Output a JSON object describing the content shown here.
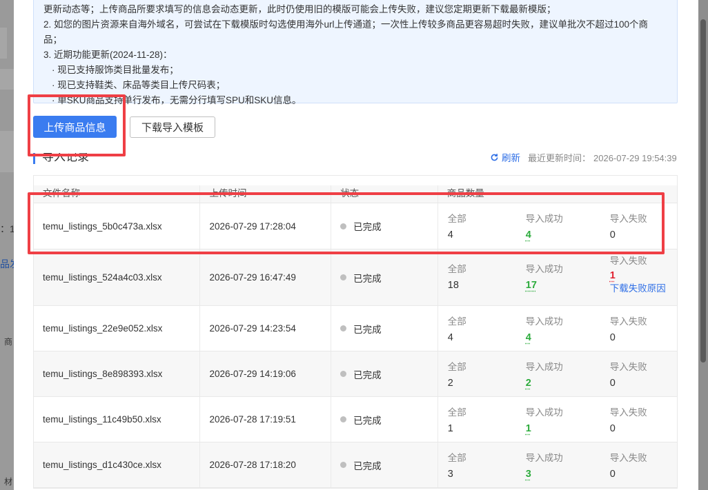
{
  "backdrop": {
    "fragment_a": "：1",
    "fragment_b": "品发",
    "fragment_c": "商",
    "fragment_d": "材"
  },
  "notice": {
    "lines": [
      "更新动态等；上传商品所要求填写的信息会动态更新，此时仍使用旧的模版可能会上传失败，建议您定期更新下载最新模版；",
      "2. 如您的图片资源来自海外域名，可尝试在下载模版时勾选使用海外url上传通道；一次性上传较多商品更容易超时失败，建议单批次不超过100个商",
      "品；",
      "3. 近期功能更新(2024-11-28)：",
      "· 现已支持服饰类目批量发布；",
      "· 现已支持鞋类、床品等类目上传尺码表；",
      "· 单SKU商品支持单行发布，无需分行填写SPU和SKU信息。"
    ]
  },
  "buttons": {
    "upload": "上传商品信息",
    "download_template": "下载导入模板"
  },
  "section": {
    "title": "导入记录",
    "refresh": "刷新",
    "updated_label": "最近更新时间：",
    "updated_time": "2026-07-29 19:54:39"
  },
  "table": {
    "headers": [
      "文件名称",
      "上传时间",
      "状态",
      "商品数量"
    ],
    "count_labels": {
      "all": "全部",
      "success": "导入成功",
      "fail": "导入失败"
    },
    "rows": [
      {
        "file": "temu_listings_5b0c473a.xlsx",
        "time": "2026-07-29 17:28:04",
        "status": "已完成",
        "all": "4",
        "success": "4",
        "fail": "0"
      },
      {
        "file": "temu_listings_524a4c03.xlsx",
        "time": "2026-07-29 16:47:49",
        "status": "已完成",
        "all": "18",
        "success": "17",
        "fail": "1",
        "fail_link": "下载失败原因"
      },
      {
        "file": "temu_listings_22e9e052.xlsx",
        "time": "2026-07-29 14:23:54",
        "status": "已完成",
        "all": "4",
        "success": "4",
        "fail": "0"
      },
      {
        "file": "temu_listings_8e898393.xlsx",
        "time": "2026-07-29 14:19:06",
        "status": "已完成",
        "all": "2",
        "success": "2",
        "fail": "0"
      },
      {
        "file": "temu_listings_11c49b50.xlsx",
        "time": "2026-07-28 17:19:51",
        "status": "已完成",
        "all": "1",
        "success": "1",
        "fail": "0"
      },
      {
        "file": "temu_listings_d1c430ce.xlsx",
        "time": "2026-07-28 17:18:20",
        "status": "已完成",
        "all": "3",
        "success": "3",
        "fail": "0"
      }
    ]
  },
  "colors": {
    "primary": "#3a7cf0",
    "success": "#2cab3c",
    "fail": "#e0202f",
    "highlight": "#ef3f45",
    "notice_bg": "#eef5ff"
  }
}
